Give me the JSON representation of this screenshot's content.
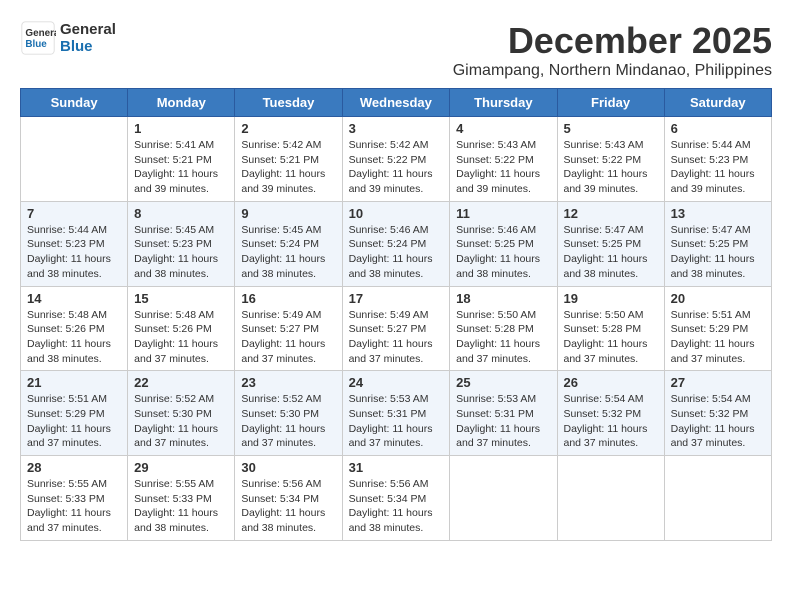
{
  "logo": {
    "line1": "General",
    "line2": "Blue"
  },
  "title": "December 2025",
  "subtitle": "Gimampang, Northern Mindanao, Philippines",
  "days_header": [
    "Sunday",
    "Monday",
    "Tuesday",
    "Wednesday",
    "Thursday",
    "Friday",
    "Saturday"
  ],
  "weeks": [
    [
      {
        "day": "",
        "sunrise": "",
        "sunset": "",
        "daylight": ""
      },
      {
        "day": "1",
        "sunrise": "Sunrise: 5:41 AM",
        "sunset": "Sunset: 5:21 PM",
        "daylight": "Daylight: 11 hours and 39 minutes."
      },
      {
        "day": "2",
        "sunrise": "Sunrise: 5:42 AM",
        "sunset": "Sunset: 5:21 PM",
        "daylight": "Daylight: 11 hours and 39 minutes."
      },
      {
        "day": "3",
        "sunrise": "Sunrise: 5:42 AM",
        "sunset": "Sunset: 5:22 PM",
        "daylight": "Daylight: 11 hours and 39 minutes."
      },
      {
        "day": "4",
        "sunrise": "Sunrise: 5:43 AM",
        "sunset": "Sunset: 5:22 PM",
        "daylight": "Daylight: 11 hours and 39 minutes."
      },
      {
        "day": "5",
        "sunrise": "Sunrise: 5:43 AM",
        "sunset": "Sunset: 5:22 PM",
        "daylight": "Daylight: 11 hours and 39 minutes."
      },
      {
        "day": "6",
        "sunrise": "Sunrise: 5:44 AM",
        "sunset": "Sunset: 5:23 PM",
        "daylight": "Daylight: 11 hours and 39 minutes."
      }
    ],
    [
      {
        "day": "7",
        "sunrise": "Sunrise: 5:44 AM",
        "sunset": "Sunset: 5:23 PM",
        "daylight": "Daylight: 11 hours and 38 minutes."
      },
      {
        "day": "8",
        "sunrise": "Sunrise: 5:45 AM",
        "sunset": "Sunset: 5:23 PM",
        "daylight": "Daylight: 11 hours and 38 minutes."
      },
      {
        "day": "9",
        "sunrise": "Sunrise: 5:45 AM",
        "sunset": "Sunset: 5:24 PM",
        "daylight": "Daylight: 11 hours and 38 minutes."
      },
      {
        "day": "10",
        "sunrise": "Sunrise: 5:46 AM",
        "sunset": "Sunset: 5:24 PM",
        "daylight": "Daylight: 11 hours and 38 minutes."
      },
      {
        "day": "11",
        "sunrise": "Sunrise: 5:46 AM",
        "sunset": "Sunset: 5:25 PM",
        "daylight": "Daylight: 11 hours and 38 minutes."
      },
      {
        "day": "12",
        "sunrise": "Sunrise: 5:47 AM",
        "sunset": "Sunset: 5:25 PM",
        "daylight": "Daylight: 11 hours and 38 minutes."
      },
      {
        "day": "13",
        "sunrise": "Sunrise: 5:47 AM",
        "sunset": "Sunset: 5:25 PM",
        "daylight": "Daylight: 11 hours and 38 minutes."
      }
    ],
    [
      {
        "day": "14",
        "sunrise": "Sunrise: 5:48 AM",
        "sunset": "Sunset: 5:26 PM",
        "daylight": "Daylight: 11 hours and 38 minutes."
      },
      {
        "day": "15",
        "sunrise": "Sunrise: 5:48 AM",
        "sunset": "Sunset: 5:26 PM",
        "daylight": "Daylight: 11 hours and 37 minutes."
      },
      {
        "day": "16",
        "sunrise": "Sunrise: 5:49 AM",
        "sunset": "Sunset: 5:27 PM",
        "daylight": "Daylight: 11 hours and 37 minutes."
      },
      {
        "day": "17",
        "sunrise": "Sunrise: 5:49 AM",
        "sunset": "Sunset: 5:27 PM",
        "daylight": "Daylight: 11 hours and 37 minutes."
      },
      {
        "day": "18",
        "sunrise": "Sunrise: 5:50 AM",
        "sunset": "Sunset: 5:28 PM",
        "daylight": "Daylight: 11 hours and 37 minutes."
      },
      {
        "day": "19",
        "sunrise": "Sunrise: 5:50 AM",
        "sunset": "Sunset: 5:28 PM",
        "daylight": "Daylight: 11 hours and 37 minutes."
      },
      {
        "day": "20",
        "sunrise": "Sunrise: 5:51 AM",
        "sunset": "Sunset: 5:29 PM",
        "daylight": "Daylight: 11 hours and 37 minutes."
      }
    ],
    [
      {
        "day": "21",
        "sunrise": "Sunrise: 5:51 AM",
        "sunset": "Sunset: 5:29 PM",
        "daylight": "Daylight: 11 hours and 37 minutes."
      },
      {
        "day": "22",
        "sunrise": "Sunrise: 5:52 AM",
        "sunset": "Sunset: 5:30 PM",
        "daylight": "Daylight: 11 hours and 37 minutes."
      },
      {
        "day": "23",
        "sunrise": "Sunrise: 5:52 AM",
        "sunset": "Sunset: 5:30 PM",
        "daylight": "Daylight: 11 hours and 37 minutes."
      },
      {
        "day": "24",
        "sunrise": "Sunrise: 5:53 AM",
        "sunset": "Sunset: 5:31 PM",
        "daylight": "Daylight: 11 hours and 37 minutes."
      },
      {
        "day": "25",
        "sunrise": "Sunrise: 5:53 AM",
        "sunset": "Sunset: 5:31 PM",
        "daylight": "Daylight: 11 hours and 37 minutes."
      },
      {
        "day": "26",
        "sunrise": "Sunrise: 5:54 AM",
        "sunset": "Sunset: 5:32 PM",
        "daylight": "Daylight: 11 hours and 37 minutes."
      },
      {
        "day": "27",
        "sunrise": "Sunrise: 5:54 AM",
        "sunset": "Sunset: 5:32 PM",
        "daylight": "Daylight: 11 hours and 37 minutes."
      }
    ],
    [
      {
        "day": "28",
        "sunrise": "Sunrise: 5:55 AM",
        "sunset": "Sunset: 5:33 PM",
        "daylight": "Daylight: 11 hours and 37 minutes."
      },
      {
        "day": "29",
        "sunrise": "Sunrise: 5:55 AM",
        "sunset": "Sunset: 5:33 PM",
        "daylight": "Daylight: 11 hours and 38 minutes."
      },
      {
        "day": "30",
        "sunrise": "Sunrise: 5:56 AM",
        "sunset": "Sunset: 5:34 PM",
        "daylight": "Daylight: 11 hours and 38 minutes."
      },
      {
        "day": "31",
        "sunrise": "Sunrise: 5:56 AM",
        "sunset": "Sunset: 5:34 PM",
        "daylight": "Daylight: 11 hours and 38 minutes."
      },
      {
        "day": "",
        "sunrise": "",
        "sunset": "",
        "daylight": ""
      },
      {
        "day": "",
        "sunrise": "",
        "sunset": "",
        "daylight": ""
      },
      {
        "day": "",
        "sunrise": "",
        "sunset": "",
        "daylight": ""
      }
    ]
  ]
}
